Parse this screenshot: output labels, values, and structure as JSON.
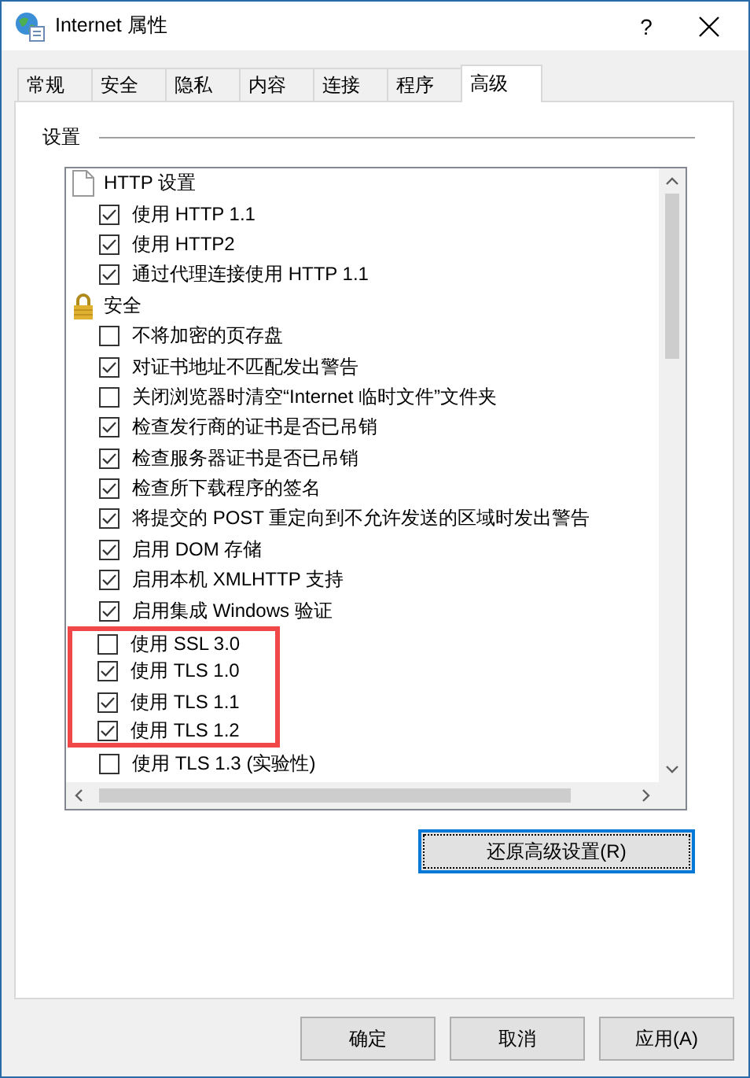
{
  "window": {
    "title": "Internet 属性",
    "help": "?"
  },
  "tabs": [
    {
      "label": "常规",
      "selected": false
    },
    {
      "label": "安全",
      "selected": false
    },
    {
      "label": "隐私",
      "selected": false
    },
    {
      "label": "内容",
      "selected": false
    },
    {
      "label": "连接",
      "selected": false
    },
    {
      "label": "程序",
      "selected": false
    },
    {
      "label": "高级",
      "selected": true
    }
  ],
  "group_label": "设置",
  "settings": [
    {
      "label": "HTTP 设置",
      "children": [
        {
          "label": "使用 HTTP 1.1",
          "checked": true,
          "highlighted": false
        },
        {
          "label": "使用 HTTP2",
          "checked": true,
          "highlighted": false
        },
        {
          "label": "通过代理连接使用 HTTP 1.1",
          "checked": true,
          "highlighted": false
        }
      ]
    },
    {
      "label": "安全",
      "children": [
        {
          "label": "不将加密的页存盘",
          "checked": false,
          "highlighted": false
        },
        {
          "label": "对证书地址不匹配发出警告",
          "checked": true,
          "highlighted": false
        },
        {
          "label": "关闭浏览器时清空“Internet 临时文件”文件夹",
          "checked": false,
          "highlighted": false
        },
        {
          "label": "检查发行商的证书是否已吊销",
          "checked": true,
          "highlighted": false
        },
        {
          "label": "检查服务器证书是否已吊销",
          "checked": true,
          "highlighted": false
        },
        {
          "label": "检查所下载程序的签名",
          "checked": true,
          "highlighted": false
        },
        {
          "label": "将提交的 POST 重定向到不允许发送的区域时发出警告",
          "checked": true,
          "highlighted": false
        },
        {
          "label": "启用 DOM 存储",
          "checked": true,
          "highlighted": false
        },
        {
          "label": "启用本机 XMLHTTP 支持",
          "checked": true,
          "highlighted": false
        },
        {
          "label": "启用集成 Windows 验证",
          "checked": true,
          "highlighted": false
        },
        {
          "label": "使用 SSL 3.0",
          "checked": false,
          "highlighted": true
        },
        {
          "label": "使用 TLS 1.0",
          "checked": true,
          "highlighted": true
        },
        {
          "label": "使用 TLS 1.1",
          "checked": true,
          "highlighted": true
        },
        {
          "label": "使用 TLS 1.2",
          "checked": true,
          "highlighted": true
        },
        {
          "label": "使用 TLS 1.3 (实验性)",
          "checked": false,
          "highlighted": false
        }
      ]
    }
  ],
  "restore_button": "还原高级设置(R)",
  "buttons": [
    "确定",
    "取消",
    "应用(A)"
  ]
}
